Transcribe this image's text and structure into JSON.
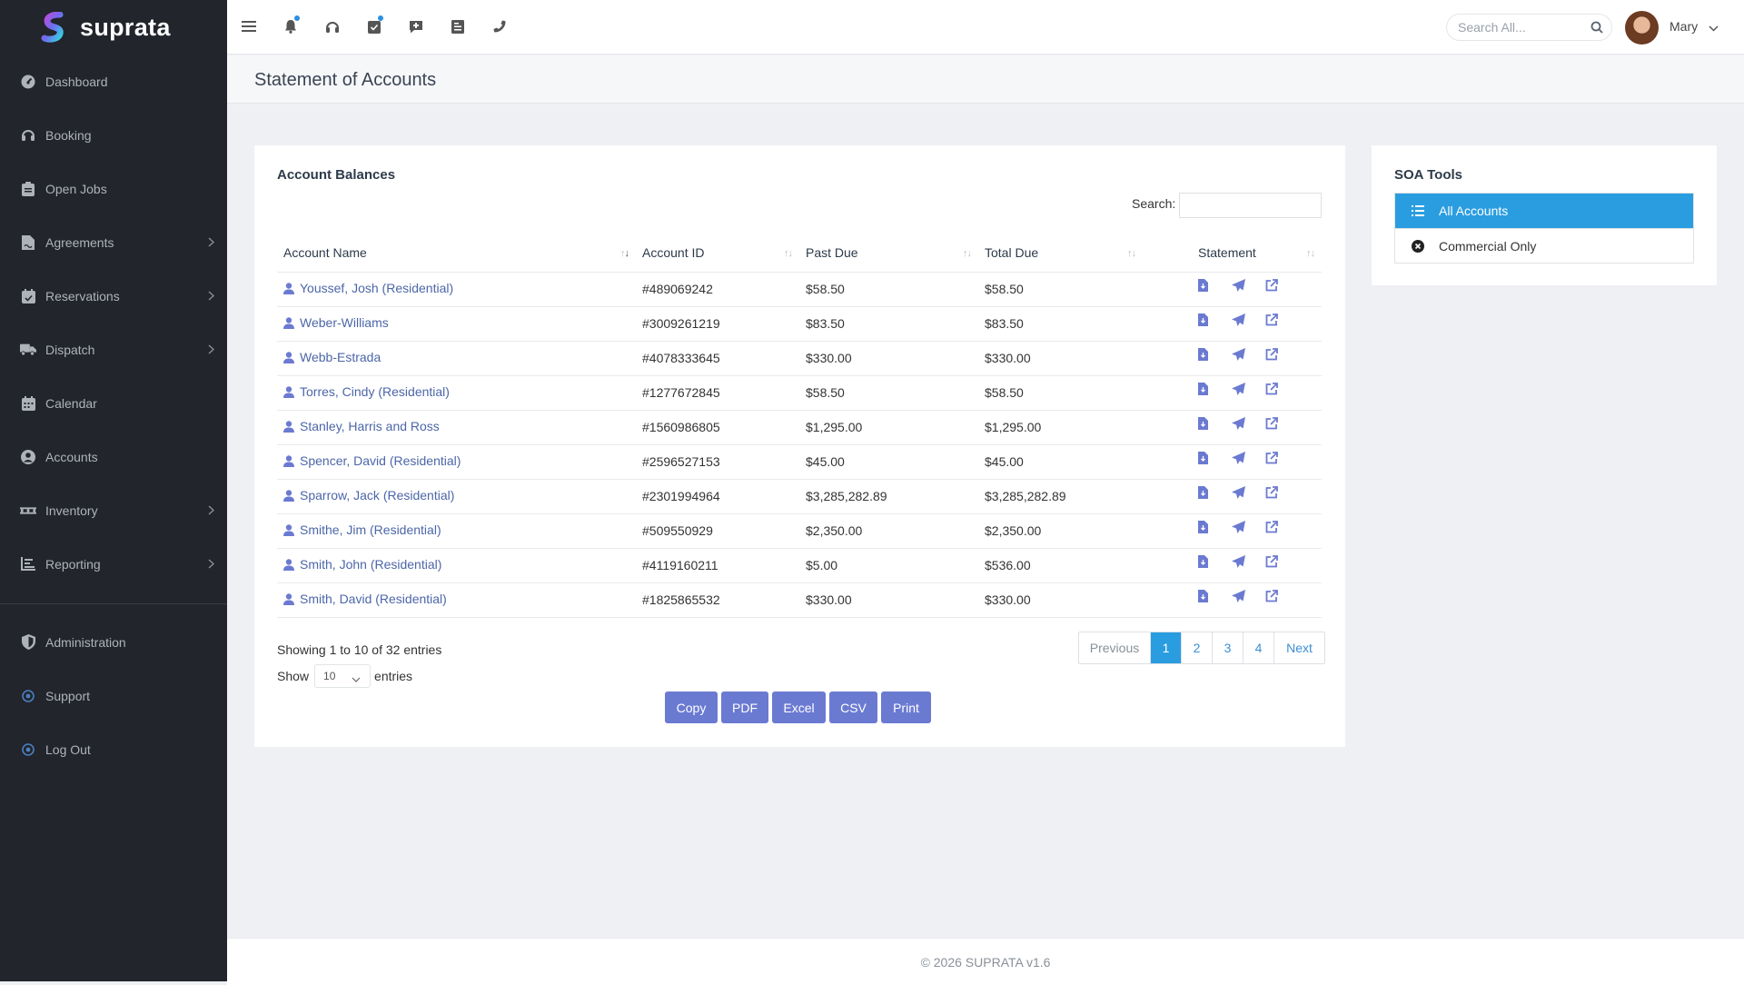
{
  "app": {
    "brand": "suprata"
  },
  "sidebar": {
    "items": [
      {
        "label": "Dashboard",
        "icon": "dashboard-icon",
        "submenu": false
      },
      {
        "label": "Booking",
        "icon": "headset-icon",
        "submenu": false
      },
      {
        "label": "Open Jobs",
        "icon": "clipboard-icon",
        "submenu": false
      },
      {
        "label": "Agreements",
        "icon": "file-signature-icon",
        "submenu": true
      },
      {
        "label": "Reservations",
        "icon": "calendar-check-icon",
        "submenu": true
      },
      {
        "label": "Dispatch",
        "icon": "truck-icon",
        "submenu": true
      },
      {
        "label": "Calendar",
        "icon": "calendar-icon",
        "submenu": false
      },
      {
        "label": "Accounts",
        "icon": "user-circle-icon",
        "submenu": false
      },
      {
        "label": "Inventory",
        "icon": "pallet-icon",
        "submenu": true
      },
      {
        "label": "Reporting",
        "icon": "chart-icon",
        "submenu": true
      }
    ],
    "bottom_items": [
      {
        "label": "Administration",
        "icon": "shield-icon"
      },
      {
        "label": "Support",
        "icon": "dot-circle-icon"
      },
      {
        "label": "Log Out",
        "icon": "dot-circle-icon"
      }
    ]
  },
  "topbar": {
    "icons": [
      "menu-icon",
      "bell-icon",
      "headphones-icon",
      "tasks-icon",
      "comment-plus-icon",
      "receipt-icon",
      "phone-icon"
    ],
    "search_placeholder": "Search All...",
    "user_name": "Mary"
  },
  "page": {
    "title": "Statement of Accounts"
  },
  "balances": {
    "title": "Account Balances",
    "search_label": "Search:",
    "columns": [
      "Account Name",
      "Account ID",
      "Past Due",
      "Total Due",
      "Statement"
    ],
    "rows": [
      {
        "name": "Youssef, Josh (Residential)",
        "id": "#489069242",
        "past_due": "$58.50",
        "total_due": "$58.50"
      },
      {
        "name": "Weber-Williams",
        "id": "#3009261219",
        "past_due": "$83.50",
        "total_due": "$83.50"
      },
      {
        "name": "Webb-Estrada",
        "id": "#4078333645",
        "past_due": "$330.00",
        "total_due": "$330.00"
      },
      {
        "name": "Torres, Cindy (Residential)",
        "id": "#1277672845",
        "past_due": "$58.50",
        "total_due": "$58.50"
      },
      {
        "name": "Stanley, Harris and Ross",
        "id": "#1560986805",
        "past_due": "$1,295.00",
        "total_due": "$1,295.00"
      },
      {
        "name": "Spencer, David (Residential)",
        "id": "#2596527153",
        "past_due": "$45.00",
        "total_due": "$45.00"
      },
      {
        "name": "Sparrow, Jack (Residential)",
        "id": "#2301994964",
        "past_due": "$3,285,282.89",
        "total_due": "$3,285,282.89"
      },
      {
        "name": "Smithe, Jim (Residential)",
        "id": "#509550929",
        "past_due": "$2,350.00",
        "total_due": "$2,350.00"
      },
      {
        "name": "Smith, John (Residential)",
        "id": "#4119160211",
        "past_due": "$5.00",
        "total_due": "$536.00"
      },
      {
        "name": "Smith, David (Residential)",
        "id": "#1825865532",
        "past_due": "$330.00",
        "total_due": "$330.00"
      }
    ],
    "statement_icons": [
      "file-download-icon",
      "paper-plane-icon",
      "external-link-icon"
    ],
    "info": "Showing 1 to 10 of 32 entries",
    "show_label": "Show",
    "page_length": "10",
    "entries_label": "entries",
    "pagination": {
      "previous": "Previous",
      "pages": [
        "1",
        "2",
        "3",
        "4"
      ],
      "active": "1",
      "next": "Next"
    },
    "export_buttons": [
      "Copy",
      "PDF",
      "Excel",
      "CSV",
      "Print"
    ]
  },
  "soa_tools": {
    "title": "SOA Tools",
    "items": [
      {
        "label": "All Accounts",
        "icon": "list-icon",
        "active": true
      },
      {
        "label": "Commercial Only",
        "icon": "times-circle-icon",
        "active": false
      }
    ]
  },
  "footer": {
    "text": "© 2026 SUPRATA v1.6"
  },
  "colors": {
    "sidebar_bg": "#22252b",
    "accent": "#2a9de0",
    "button": "#6b7ad1",
    "link": "#4c66a8"
  }
}
